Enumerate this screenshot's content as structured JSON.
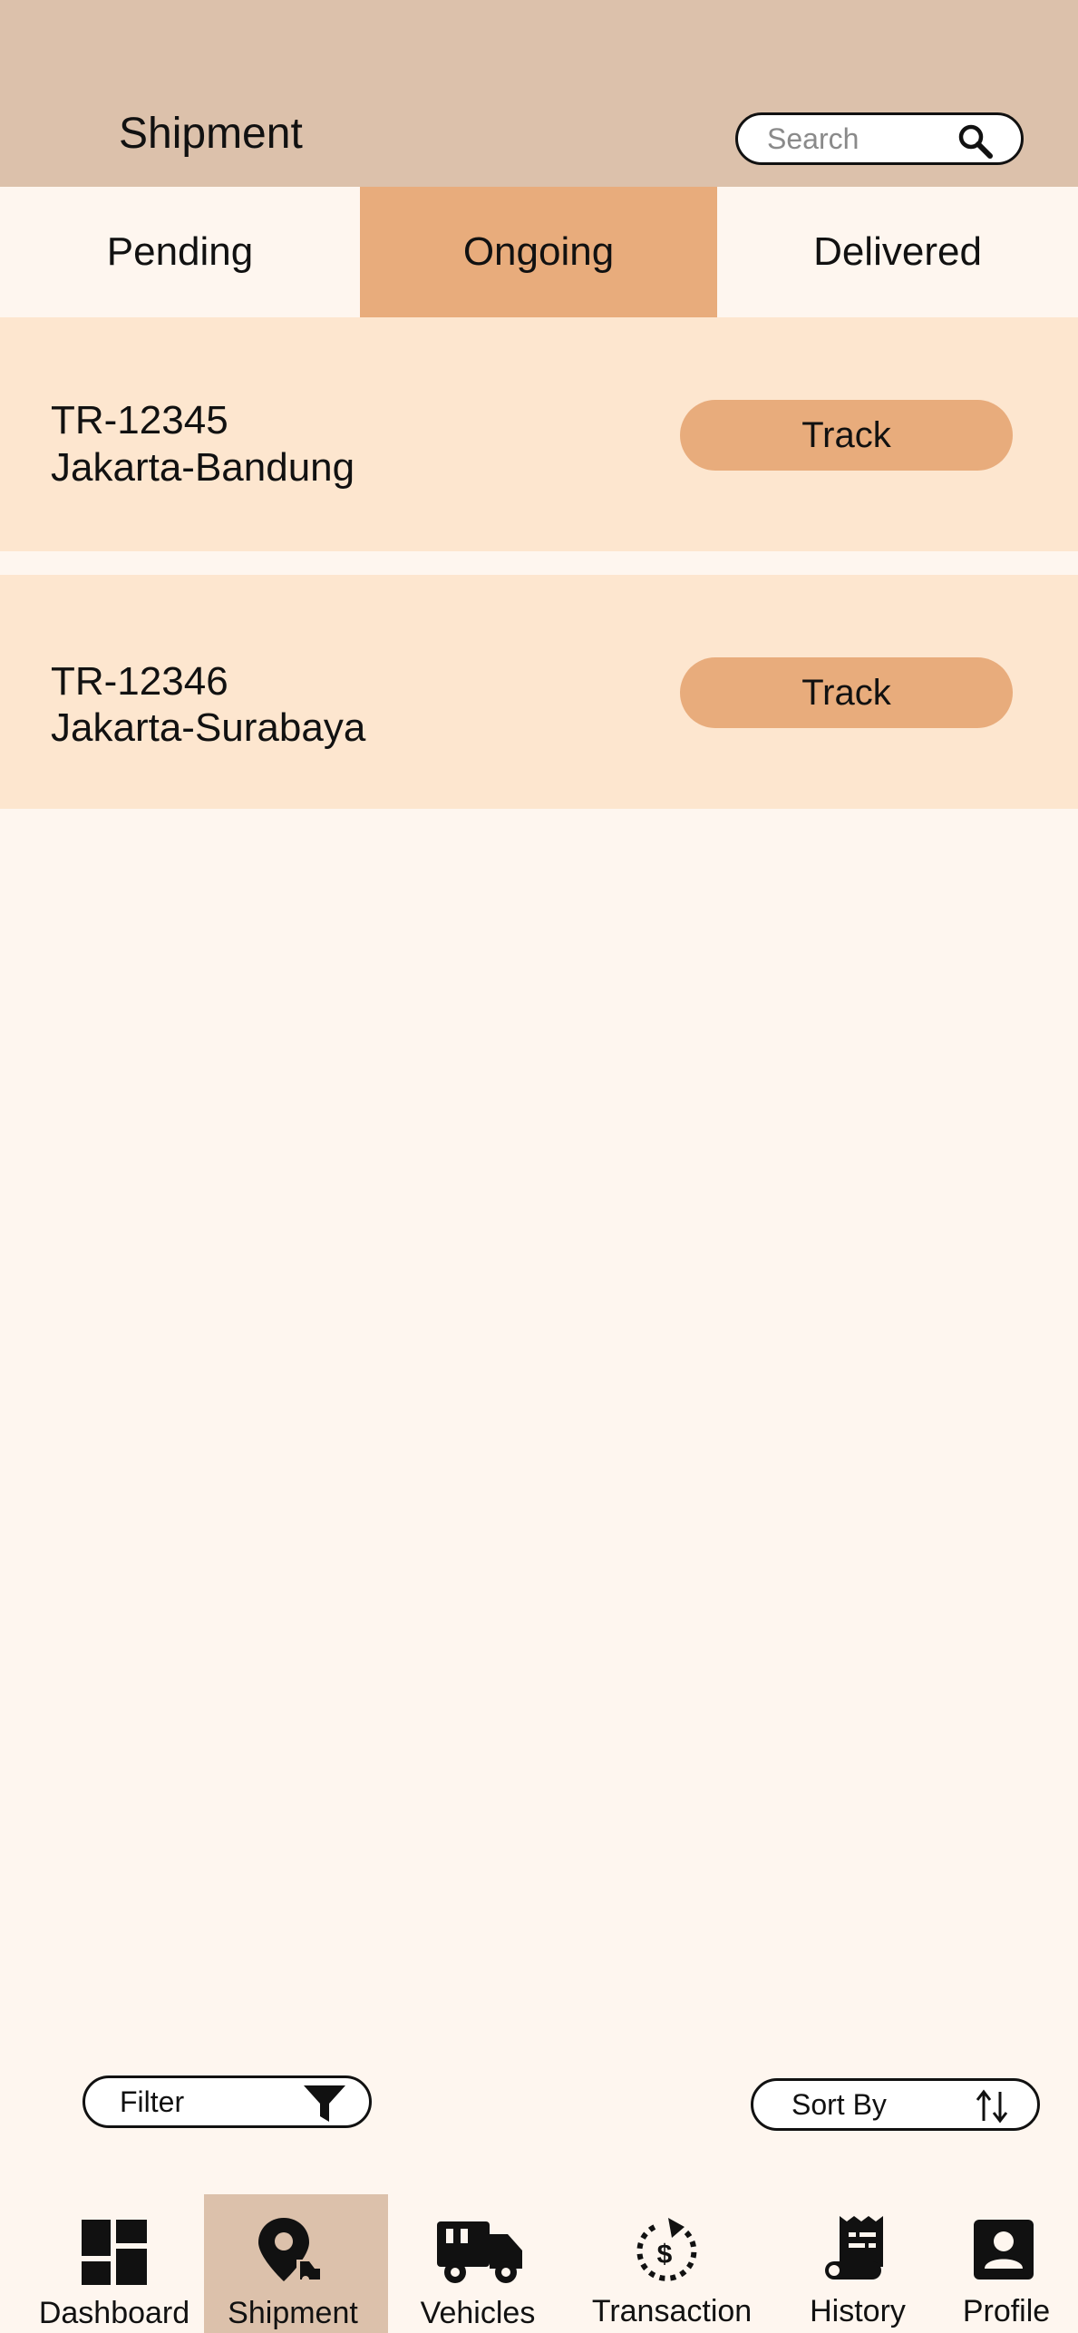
{
  "header": {
    "title": "Shipment",
    "search_placeholder": "Search"
  },
  "tabs": [
    {
      "label": "Pending",
      "active": false
    },
    {
      "label": "Ongoing",
      "active": true
    },
    {
      "label": "Delivered",
      "active": false
    }
  ],
  "shipments": [
    {
      "id": "TR-12345",
      "route": "Jakarta-Bandung",
      "action": "Track"
    },
    {
      "id": "TR-12346",
      "route": "Jakarta-Surabaya",
      "action": "Track"
    }
  ],
  "controls": {
    "filter_label": "Filter",
    "sort_label": "Sort By"
  },
  "nav": [
    {
      "label": "Dashboard",
      "icon": "dashboard-icon",
      "active": false
    },
    {
      "label": "Shipment",
      "icon": "location-pin-icon",
      "active": true
    },
    {
      "label": "Vehicles",
      "icon": "truck-icon",
      "active": false
    },
    {
      "label": "Transaction",
      "icon": "dollar-refresh-icon",
      "active": false
    },
    {
      "label": "History",
      "icon": "receipt-icon",
      "active": false
    },
    {
      "label": "Profile",
      "icon": "profile-icon",
      "active": false
    }
  ],
  "colors": {
    "header_bg": "#dcc1ab",
    "page_bg": "#fef6ef",
    "card_bg": "#fde6cf",
    "accent": "#e8ac7c"
  }
}
